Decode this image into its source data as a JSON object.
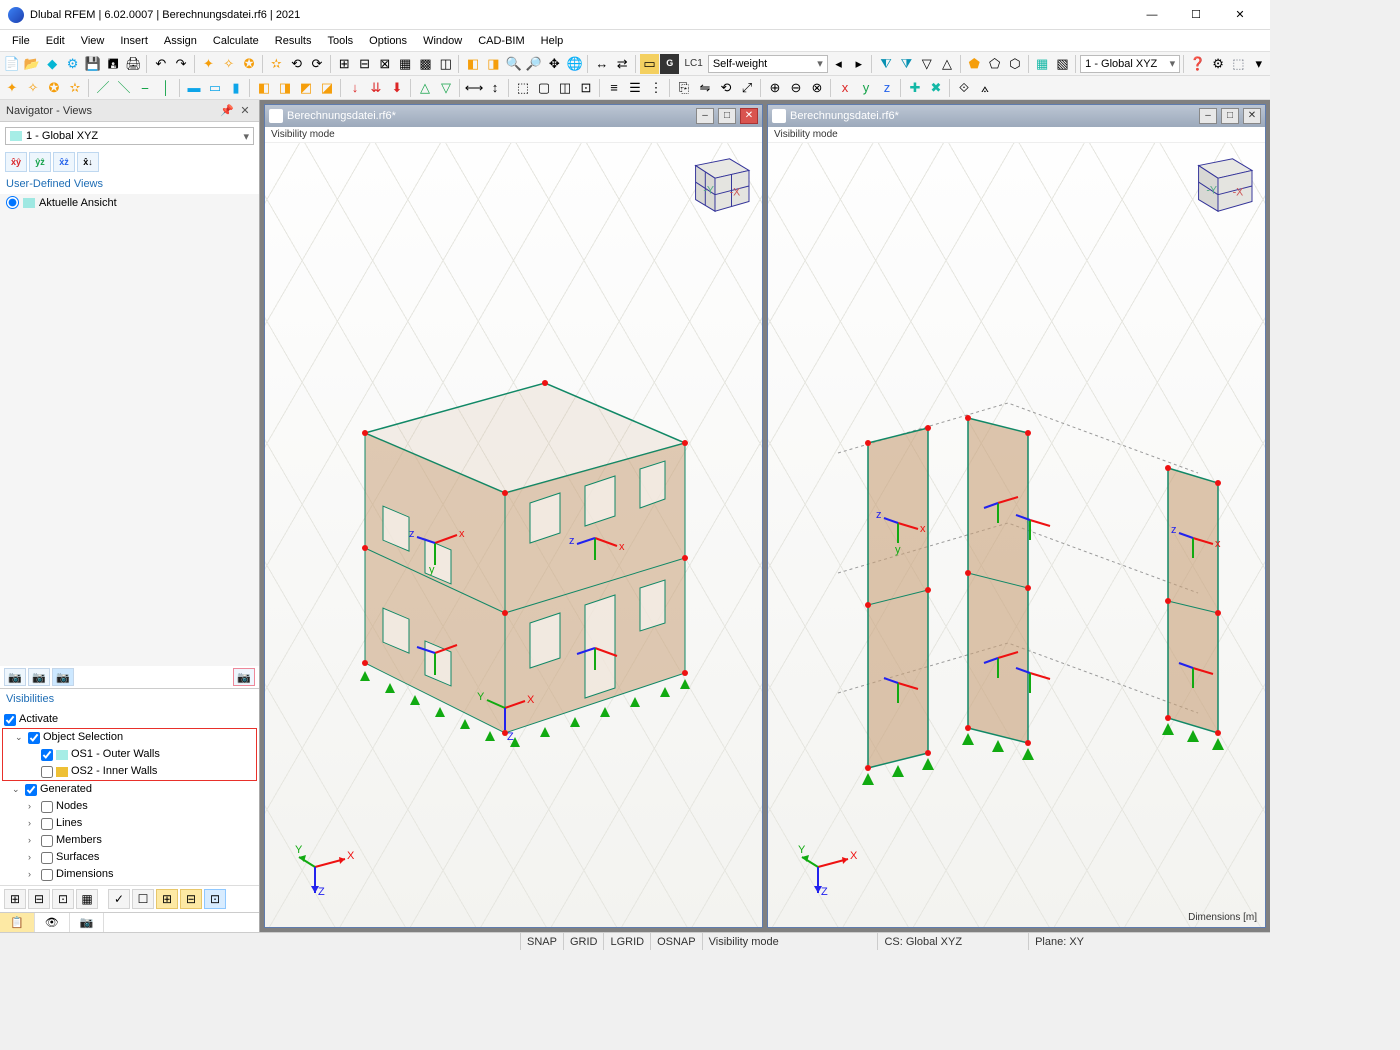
{
  "window": {
    "title": "Dlubal RFEM | 6.02.0007 | Berechnungsdatei.rf6 | 2021"
  },
  "menu": [
    "File",
    "Edit",
    "View",
    "Insert",
    "Assign",
    "Calculate",
    "Results",
    "Tools",
    "Options",
    "Window",
    "CAD-BIM",
    "Help"
  ],
  "toolbar1": {
    "lc_label": "LC1",
    "lc_name": "Self-weight",
    "global_cs": "1 - Global XYZ"
  },
  "navigator": {
    "title": "Navigator - Views",
    "combo": "1 - Global XYZ",
    "user_views_title": "User-Defined Views",
    "current_view": "Aktuelle Ansicht",
    "visibilities_title": "Visibilities",
    "activate": "Activate",
    "object_selection": "Object Selection",
    "os1": "OS1 - Outer Walls",
    "os2": "OS2 - Inner Walls",
    "generated": "Generated",
    "gen_items": [
      "Nodes",
      "Lines",
      "Members",
      "Surfaces",
      "Dimensions"
    ]
  },
  "mdi": {
    "doc_title": "Berechnungsdatei.rf6*",
    "subtext": "Visibility mode",
    "dim_label": "Dimensions [m]"
  },
  "orient": {
    "x": "X",
    "y": "Y",
    "z": "Z"
  },
  "status": {
    "snap": "SNAP",
    "grid": "GRID",
    "lgrid": "LGRID",
    "osnap": "OSNAP",
    "vmode": "Visibility mode",
    "cs": "CS: Global XYZ",
    "plane": "Plane: XY"
  },
  "icons_tb1": [
    "📄",
    "📂",
    "🐝",
    "💾",
    "🖨",
    "↶",
    "↷",
    "📋",
    "📎",
    "🧭",
    "🧮",
    "⚙",
    "🔧",
    "📐",
    "📊",
    "⊞",
    "⊟",
    "⊠",
    "⊡",
    "⬛",
    "◻",
    "🔍",
    "🔎",
    "🌐",
    "🖱",
    "✥",
    "🧲",
    "↔",
    "⇄"
  ],
  "icons_tb2": [
    "✦",
    "✧",
    "✪",
    "✫",
    "⚡",
    "⟲",
    "⟳",
    "↗",
    "↘",
    "🔺",
    "🔻",
    "◧",
    "◨",
    "◩",
    "◪",
    "▦",
    "▧",
    "▨",
    "▩",
    "◫",
    "⬚",
    "⬛",
    "⬜",
    "🟦",
    "🟥",
    "🟩",
    "🟨",
    "⬟",
    "⬠",
    "⬡",
    "▭",
    "▮",
    "▯",
    "△",
    "▽",
    "◁",
    "▷",
    "☰",
    "☷",
    "≡",
    "⋮"
  ]
}
